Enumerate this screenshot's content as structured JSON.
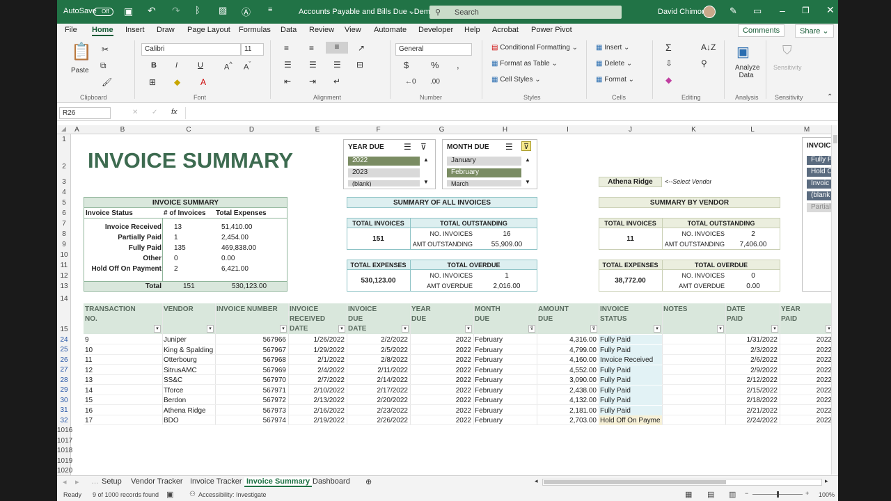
{
  "titlebar": {
    "autosave": "AutoSave",
    "toggle": "Off",
    "doc_title": "Accounts Payable and Bills Due - Demo",
    "search_placeholder": "Search",
    "user": "David Chimon"
  },
  "menu": [
    "File",
    "Home",
    "Insert",
    "Draw",
    "Page Layout",
    "Formulas",
    "Data",
    "Review",
    "View",
    "Automate",
    "Developer",
    "Help",
    "Acrobat",
    "Power Pivot"
  ],
  "menu_right": {
    "comments": "Comments",
    "share": "Share"
  },
  "ribbon": {
    "paste": "Paste",
    "font_name": "Calibri",
    "font_size": "11",
    "number_format": "General",
    "conditional": "Conditional Formatting",
    "format_table": "Format as Table",
    "cell_styles": "Cell Styles",
    "insert": "Insert",
    "delete": "Delete",
    "format": "Format",
    "analyze": "Analyze Data",
    "sensitivity": "Sensitivity",
    "groups": {
      "clipboard": "Clipboard",
      "font": "Font",
      "alignment": "Alignment",
      "number": "Number",
      "styles": "Styles",
      "cells": "Cells",
      "editing": "Editing",
      "analysis": "Analysis",
      "sensitivity": "Sensitivity"
    }
  },
  "namebox": "R26",
  "columns": [
    "A",
    "B",
    "C",
    "D",
    "E",
    "F",
    "G",
    "H",
    "I",
    "J",
    "K",
    "L",
    "M"
  ],
  "rows": [
    "1",
    "2",
    "3",
    "4",
    "5",
    "6",
    "7",
    "8",
    "9",
    "10",
    "11",
    "12",
    "13",
    "14",
    "15",
    "24",
    "25",
    "26",
    "27",
    "28",
    "29",
    "30",
    "31",
    "32",
    "1016",
    "1017",
    "1018",
    "1019",
    "1020"
  ],
  "title": "INVOICE SUMMARY",
  "slicers": {
    "year": {
      "title": "YEAR DUE",
      "items": [
        "2022",
        "2023",
        "(blank)"
      ]
    },
    "month": {
      "title": "MONTH DUE",
      "items": [
        "January",
        "February",
        "March"
      ]
    },
    "invoice": {
      "title": "INVOICE",
      "items": [
        "Fully P",
        "Hold O",
        "Invoic",
        "(blank",
        "Partial"
      ]
    }
  },
  "vendor_select": {
    "value": "Athena Ridge",
    "hint": "<--Select Vendor"
  },
  "summary_left": {
    "title": "INVOICE SUMMARY",
    "headers": [
      "Invoice Status",
      "# of Invoices",
      "Total Expenses"
    ],
    "rows": [
      [
        "Invoice Received",
        "13",
        "51,410.00"
      ],
      [
        "Partially Paid",
        "1",
        "2,454.00"
      ],
      [
        "Fully Paid",
        "135",
        "469,838.00"
      ],
      [
        "Other",
        "0",
        "0.00"
      ],
      [
        "Hold Off On Payment",
        "2",
        "6,421.00"
      ]
    ],
    "total": [
      "Total",
      "151",
      "530,123.00"
    ]
  },
  "summary_all": {
    "title": "SUMMARY OF ALL INVOICES",
    "total_invoices_label": "TOTAL INVOICES",
    "total_invoices": "151",
    "total_outstanding_label": "TOTAL OUTSTANDING",
    "no_invoices_label": "NO. INVOICES",
    "no_invoices": "16",
    "amt_outstanding_label": "AMT OUTSTANDING",
    "amt_outstanding": "55,909.00",
    "total_expenses_label": "TOTAL EXPENSES",
    "total_expenses": "530,123.00",
    "total_overdue_label": "TOTAL OVERDUE",
    "overdue_no": "1",
    "amt_overdue_label": "AMT OVERDUE",
    "amt_overdue": "2,016.00"
  },
  "summary_vendor": {
    "title": "SUMMARY BY VENDOR",
    "total_invoices_label": "TOTAL INVOICES",
    "total_invoices": "11",
    "total_outstanding_label": "TOTAL OUTSTANDING",
    "no_invoices_label": "NO. INVOICES",
    "no_invoices": "2",
    "amt_outstanding_label": "AMT OUTSTANDING",
    "amt_outstanding": "7,406.00",
    "total_expenses_label": "TOTAL EXPENSES",
    "total_expenses": "38,772.00",
    "total_overdue_label": "TOTAL OVERDUE",
    "overdue_no": "0",
    "amt_overdue_label": "AMT OVERDUE",
    "amt_overdue": "0.00"
  },
  "table": {
    "headers": [
      [
        "TRANSACTION",
        "NO.",
        ""
      ],
      [
        "VENDOR",
        "",
        ""
      ],
      [
        "INVOICE NUMBER",
        "",
        ""
      ],
      [
        "INVOICE",
        "RECEIVED",
        "DATE"
      ],
      [
        "INVOICE",
        "DUE",
        "DATE"
      ],
      [
        "YEAR",
        "DUE",
        ""
      ],
      [
        "MONTH",
        "DUE",
        ""
      ],
      [
        "AMOUNT",
        "DUE",
        ""
      ],
      [
        "INVOICE",
        "STATUS",
        ""
      ],
      [
        "NOTES",
        "",
        ""
      ],
      [
        "DATE",
        "PAID",
        ""
      ],
      [
        "YEAR",
        "PAID",
        ""
      ]
    ],
    "rows": [
      [
        "9",
        "Juniper",
        "567966",
        "1/26/2022",
        "2/2/2022",
        "2022",
        "February",
        "4,316.00",
        "Fully Paid",
        "",
        "1/31/2022",
        "2022"
      ],
      [
        "10",
        "King & Spalding",
        "567967",
        "1/29/2022",
        "2/5/2022",
        "2022",
        "February",
        "4,799.00",
        "Fully Paid",
        "",
        "2/3/2022",
        "2022"
      ],
      [
        "11",
        "Otterbourg",
        "567968",
        "2/1/2022",
        "2/8/2022",
        "2022",
        "February",
        "4,160.00",
        "Invoice Received",
        "",
        "2/6/2022",
        "2022"
      ],
      [
        "12",
        "SitrusAMC",
        "567969",
        "2/4/2022",
        "2/11/2022",
        "2022",
        "February",
        "4,552.00",
        "Fully Paid",
        "",
        "2/9/2022",
        "2022"
      ],
      [
        "13",
        "SS&C",
        "567970",
        "2/7/2022",
        "2/14/2022",
        "2022",
        "February",
        "3,090.00",
        "Fully Paid",
        "",
        "2/12/2022",
        "2022"
      ],
      [
        "14",
        "Tforce",
        "567971",
        "2/10/2022",
        "2/17/2022",
        "2022",
        "February",
        "2,438.00",
        "Fully Paid",
        "",
        "2/15/2022",
        "2022"
      ],
      [
        "15",
        "Berdon",
        "567972",
        "2/13/2022",
        "2/20/2022",
        "2022",
        "February",
        "4,132.00",
        "Fully Paid",
        "",
        "2/18/2022",
        "2022"
      ],
      [
        "16",
        "Athena Ridge",
        "567973",
        "2/16/2022",
        "2/23/2022",
        "2022",
        "February",
        "2,181.00",
        "Fully Paid",
        "",
        "2/21/2022",
        "2022"
      ],
      [
        "17",
        "BDO",
        "567974",
        "2/19/2022",
        "2/26/2022",
        "2022",
        "February",
        "2,703.00",
        "Hold Off On Payment",
        "",
        "2/24/2022",
        "2022"
      ]
    ]
  },
  "sheets": [
    "Setup",
    "Vendor Tracker",
    "Invoice Tracker",
    "Invoice Summary",
    "Dashboard"
  ],
  "status": {
    "ready": "Ready",
    "records": "9 of 1000 records found",
    "accessibility": "Accessibility: Investigate",
    "zoom": "100%"
  }
}
